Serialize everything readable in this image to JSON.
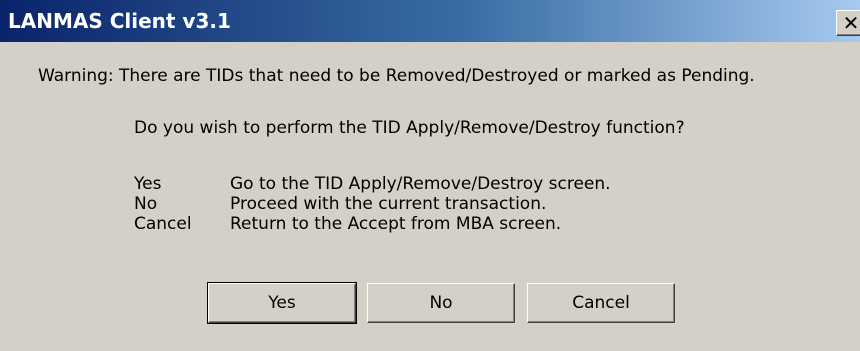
{
  "window": {
    "title": "LANMAS Client v3.1",
    "close_glyph": "✕"
  },
  "message": {
    "warning": "Warning: There are TIDs that need to be Removed/Destroyed or marked as Pending.",
    "question": "Do you wish to perform the TID Apply/Remove/Destroy function?",
    "options": [
      {
        "key": "Yes",
        "description": "Go to the TID Apply/Remove/Destroy screen."
      },
      {
        "key": "No",
        "description": "Proceed with the current transaction."
      },
      {
        "key": "Cancel",
        "description": "Return to the Accept from MBA screen."
      }
    ]
  },
  "buttons": {
    "yes_label": "Yes",
    "no_label": "No",
    "cancel_label": "Cancel"
  }
}
